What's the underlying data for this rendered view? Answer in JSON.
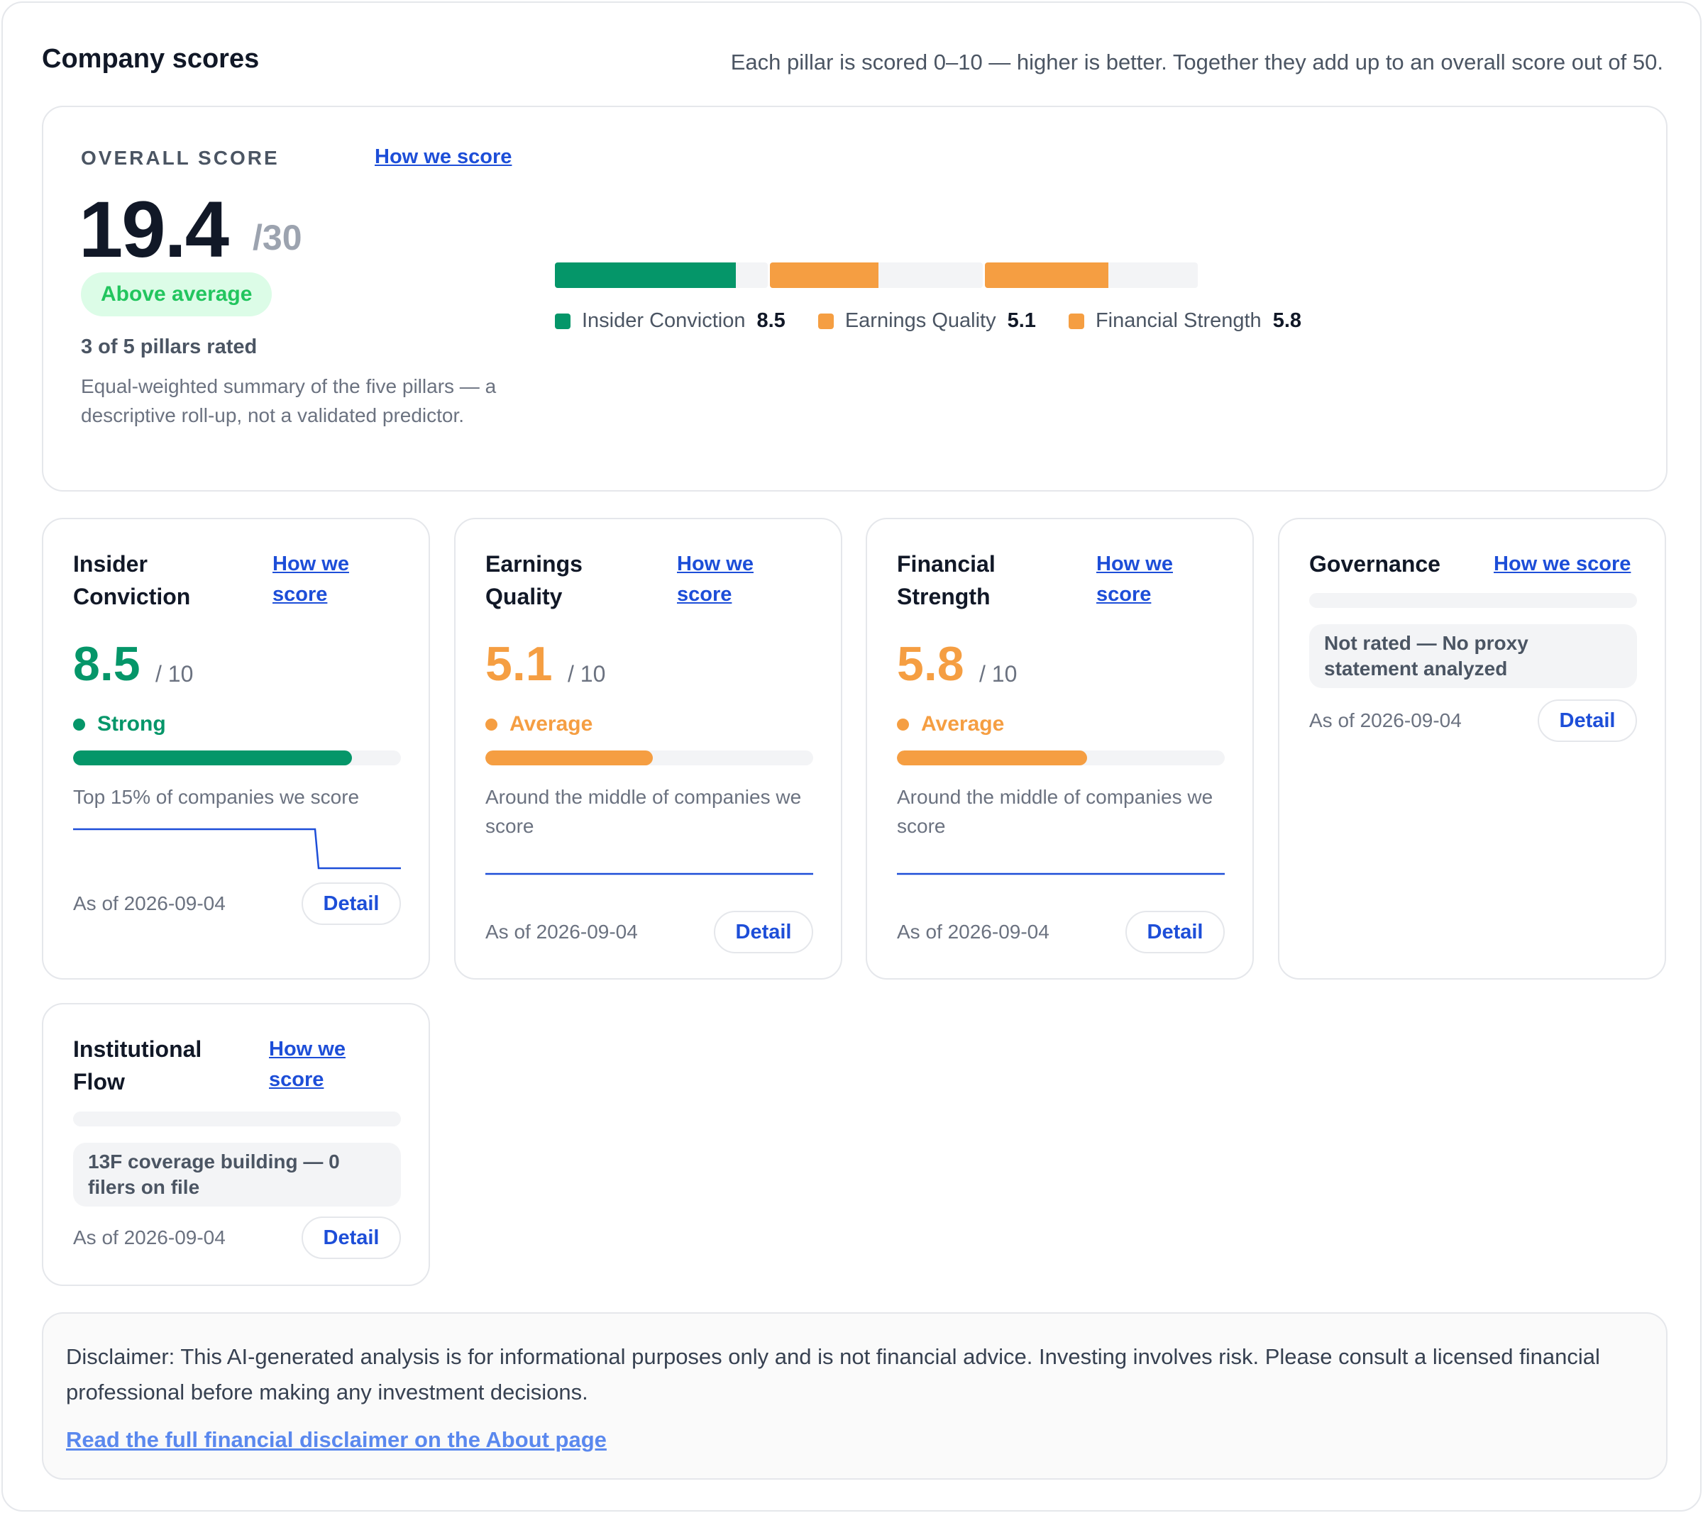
{
  "header": {
    "title": "Company scores",
    "subtitle": "Each pillar is scored 0–10 — higher is better. Together they add up to an overall score out of 50."
  },
  "overall": {
    "label": "OVERALL SCORE",
    "how_link": "How we score",
    "score": "19.4",
    "max": "/30",
    "badge": "Above average",
    "rated": "3 of 5 pillars rated",
    "description": "Equal-weighted summary of the five pillars — a descriptive roll-up, not a validated predictor.",
    "segments": [
      {
        "name": "Insider Conviction",
        "value": "8.5",
        "score": 8.5,
        "color": "#059669"
      },
      {
        "name": "Earnings Quality",
        "value": "5.1",
        "score": 5.1,
        "color": "#f59e42"
      },
      {
        "name": "Financial Strength",
        "value": "5.8",
        "score": 5.8,
        "color": "#f59e42"
      }
    ]
  },
  "pillars": {
    "insider": {
      "name": "Insider Conviction",
      "how_link": "How we score",
      "score": "8.5",
      "max": "/ 10",
      "status": "Strong",
      "color": "#059669",
      "fraction": 0.85,
      "description": "Top 15% of companies we score",
      "as_of": "As of 2026-09-04",
      "detail": "Detail"
    },
    "earnings": {
      "name": "Earnings Quality",
      "how_link": "How we score",
      "score": "5.1",
      "max": "/ 10",
      "status": "Average",
      "color": "#f59e42",
      "fraction": 0.51,
      "description": "Around the middle of companies we score",
      "as_of": "As of 2026-09-04",
      "detail": "Detail"
    },
    "financial": {
      "name": "Financial Strength",
      "how_link": "How we score",
      "score": "5.8",
      "max": "/ 10",
      "status": "Average",
      "color": "#f59e42",
      "fraction": 0.58,
      "description": "Around the middle of companies we score",
      "as_of": "As of 2026-09-04",
      "detail": "Detail"
    },
    "governance": {
      "name": "Governance",
      "how_link": "How we score",
      "note": "Not rated — No proxy statement analyzed",
      "as_of": "As of 2026-09-04",
      "detail": "Detail"
    },
    "institutional": {
      "name": "Institutional Flow",
      "how_link": "How we score",
      "note": "13F coverage building — 0 filers on file",
      "as_of": "As of 2026-09-04",
      "detail": "Detail"
    }
  },
  "disclaimer": {
    "text": "Disclaimer: This AI-generated analysis is for informational purposes only and is not financial advice. Investing involves risk. Please consult a licensed financial professional before making any investment decisions.",
    "link": "Read the full financial disclaimer on the About page"
  },
  "colors": {
    "strong": "#059669",
    "average": "#f59e42",
    "link": "#1d4ed8",
    "sparkline": "#1d4ed8"
  }
}
